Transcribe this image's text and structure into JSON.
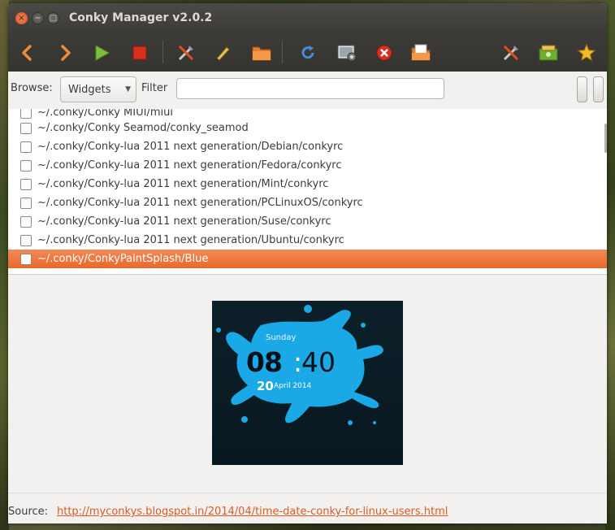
{
  "window": {
    "title": "Conky Manager v2.0.2",
    "close_glyph": "×",
    "minimize_glyph": "−",
    "maximize_glyph": "□"
  },
  "toolbar": {
    "buttons": [
      {
        "name": "back",
        "icon": "chevron-left-icon"
      },
      {
        "name": "forward",
        "icon": "chevron-right-icon"
      },
      {
        "name": "start",
        "icon": "play-icon"
      },
      {
        "name": "stop",
        "icon": "stop-icon"
      },
      {
        "name": "edit",
        "icon": "tools-icon"
      },
      {
        "name": "rename",
        "icon": "pencil-icon"
      },
      {
        "name": "open-folder",
        "icon": "folder-icon"
      },
      {
        "name": "refresh",
        "icon": "refresh-icon"
      },
      {
        "name": "generate-preview",
        "icon": "screen-gear-icon"
      },
      {
        "name": "kill",
        "icon": "close-circle-icon"
      },
      {
        "name": "import",
        "icon": "folder-import-icon"
      },
      {
        "name": "settings",
        "icon": "tools-icon"
      },
      {
        "name": "donate",
        "icon": "money-icon"
      },
      {
        "name": "about",
        "icon": "star-icon"
      }
    ],
    "colors": {
      "orange": "#f0893a",
      "green": "#7cbf3a",
      "red": "#d8301f",
      "blue": "#4a8bd6"
    }
  },
  "browse": {
    "label": "Browse:",
    "selected": "Widgets",
    "filter_label": "Filter",
    "filter_value": "",
    "filter_placeholder": ""
  },
  "widgets": {
    "partial_item": "~/.conky/Conky MIUI/miui",
    "items": [
      "~/.conky/Conky Seamod/conky_seamod",
      "~/.conky/Conky-lua 2011 next generation/Debian/conkyrc",
      "~/.conky/Conky-lua 2011 next generation/Fedora/conkyrc",
      "~/.conky/Conky-lua 2011 next generation/Mint/conkyrc",
      "~/.conky/Conky-lua 2011 next generation/PCLinuxOS/conkyrc",
      "~/.conky/Conky-lua 2011 next generation/Suse/conkyrc",
      "~/.conky/Conky-lua 2011 next generation/Ubuntu/conkyrc"
    ],
    "selected_item": "~/.conky/ConkyPaintSplash/Blue",
    "selection_color": "#e96c2e"
  },
  "preview": {
    "day": "Sunday",
    "hour": "08",
    "separator": ":",
    "minute": "40",
    "date_num": "20",
    "month_year": "April 2014",
    "splash_color": "#1aa9e6"
  },
  "source": {
    "label": "Source:",
    "url": "http://myconkys.blogspot.in/2014/04/time-date-conky-for-linux-users.html"
  }
}
